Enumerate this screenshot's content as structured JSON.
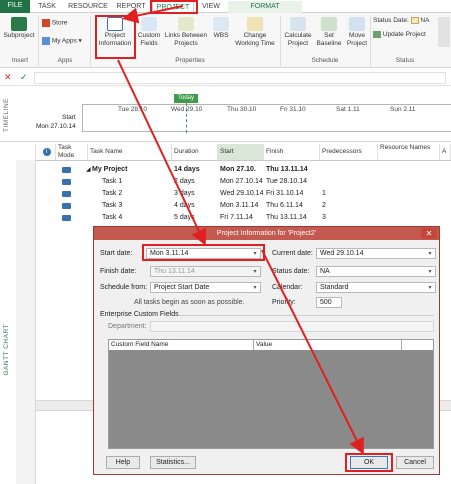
{
  "tabs": {
    "file": "FILE",
    "task": "TASK",
    "resource": "RESOURCE",
    "report": "REPORT",
    "project": "PROJECT",
    "view": "VIEW",
    "format": "FORMAT"
  },
  "ribbon": {
    "subproject": "Subproject",
    "store": "Store",
    "myapps": "My Apps",
    "project_info": "Project Information",
    "custom_fields": "Custom Fields",
    "links": "Links Between Projects",
    "wbs": "WBS",
    "change_time": "Change Working Time",
    "calculate": "Calculate Project",
    "set_baseline": "Set Baseline",
    "move_project": "Move Project",
    "status_date_label": "Status Date:",
    "status_date_value": "NA",
    "update_project": "Update Project",
    "groups": {
      "insert": "Insert",
      "apps": "Apps",
      "properties": "Properties",
      "schedule": "Schedule",
      "status": "Status"
    }
  },
  "timeline": {
    "vertical_label": "TIMELINE",
    "today": "Today",
    "start_label": "Start",
    "start_date": "Mon 27.10.14",
    "ticks": [
      "Tue 28.10",
      "Wed 29.10",
      "Thu 30.10",
      "Fri 31.10",
      "Sat 1.11",
      "Sun 2.11"
    ]
  },
  "grid": {
    "vertical_label": "GANTT CHART",
    "headers": {
      "task_mode": "Task Mode",
      "task_name": "Task Name",
      "duration": "Duration",
      "start": "Start",
      "finish": "Finish",
      "predecessors": "Predecessors",
      "resource": "Resource Names",
      "add": "A"
    },
    "rows": [
      {
        "id": "0",
        "name": "My Project",
        "duration": "14 days",
        "start": "Mon 27.10.",
        "finish": "Thu 13.11.14",
        "pred": ""
      },
      {
        "id": "1",
        "name": "Task 1",
        "duration": "2 days",
        "start": "Mon 27.10.14",
        "finish": "Tue 28.10.14",
        "pred": ""
      },
      {
        "id": "2",
        "name": "Task 2",
        "duration": "3 days",
        "start": "Wed 29.10.14",
        "finish": "Fri 31.10.14",
        "pred": "1"
      },
      {
        "id": "3",
        "name": "Task 3",
        "duration": "4 days",
        "start": "Mon 3.11.14",
        "finish": "Thu 6.11.14",
        "pred": "2"
      },
      {
        "id": "4",
        "name": "Task 4",
        "duration": "5 days",
        "start": "Fri 7.11.14",
        "finish": "Thu 13.11.14",
        "pred": "3"
      }
    ]
  },
  "dialog": {
    "title": "Project Information for 'Project2'",
    "start_date_label": "Start date:",
    "start_date": "Mon 3.11.14",
    "finish_date_label": "Finish date:",
    "finish_date": "Thu 13.11.14",
    "schedule_from_label": "Schedule from:",
    "schedule_from": "Project Start Date",
    "note": "All tasks begin as soon as possible.",
    "current_date_label": "Current date:",
    "current_date": "Wed 29.10.14",
    "status_date_label": "Status date:",
    "status_date": "NA",
    "calendar_label": "Calendar:",
    "calendar": "Standard",
    "priority_label": "Priority:",
    "priority": "500",
    "ecf_label": "Enterprise Custom Fields",
    "department_label": "Department:",
    "col_field": "Custom Field Name",
    "col_value": "Value",
    "help": "Help",
    "statistics": "Statistics...",
    "ok": "OK",
    "cancel": "Cancel"
  },
  "colors": {
    "accent": "#217346",
    "highlight": "#e02020",
    "dialog_title": "#c3594f"
  }
}
